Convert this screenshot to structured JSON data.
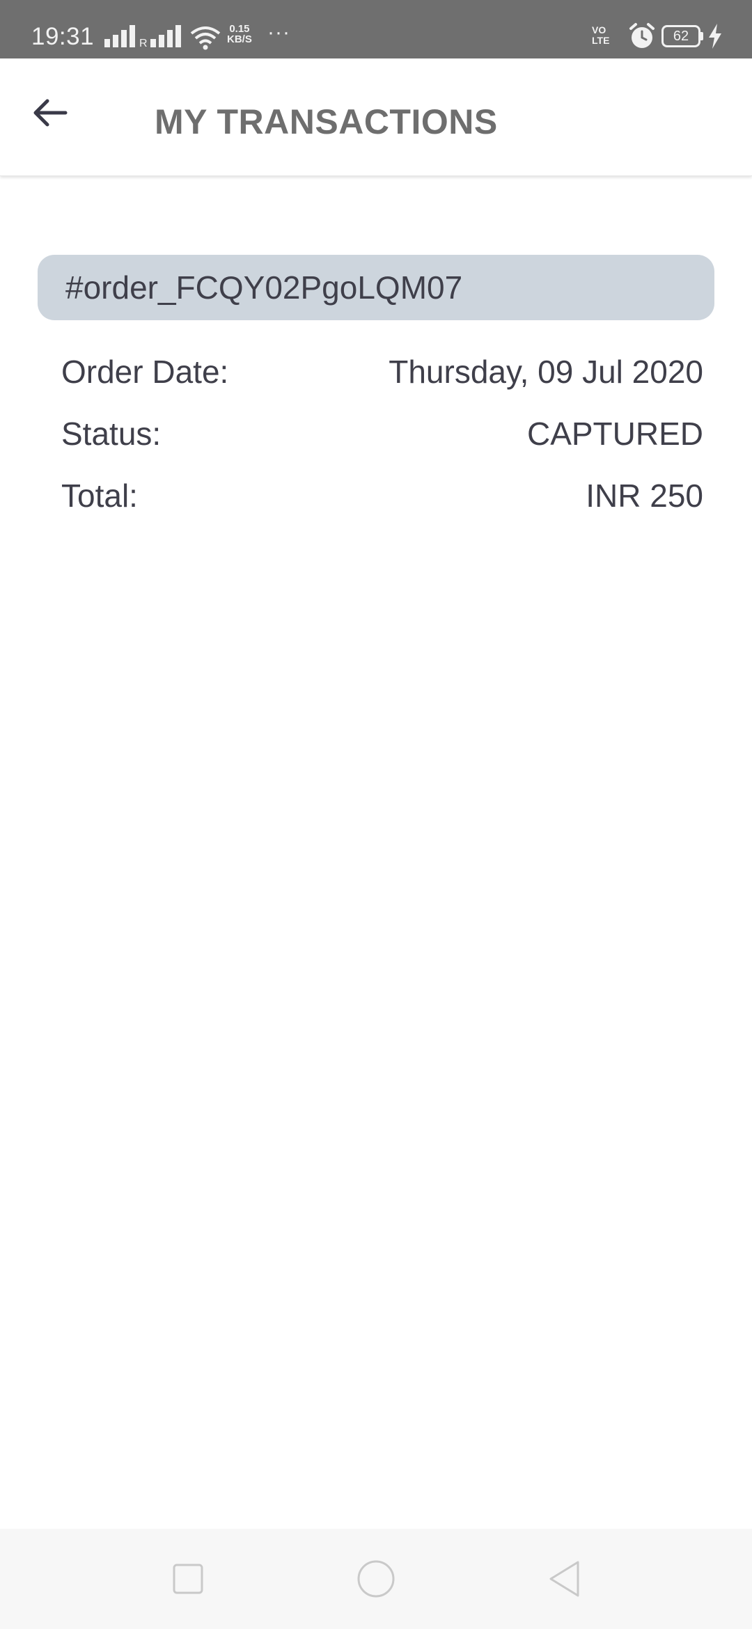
{
  "status_bar": {
    "time": "19:31",
    "network_speed_value": "0.15",
    "network_speed_unit": "KB/S",
    "overflow_dots": "···",
    "volte_top": "VO",
    "volte_bottom": "LTE",
    "battery_level": "62"
  },
  "app_bar": {
    "title": "MY TRANSACTIONS"
  },
  "order": {
    "id": "#order_FCQY02PgoLQM07",
    "rows": [
      {
        "label": "Order Date:",
        "value": "Thursday, 09 Jul 2020"
      },
      {
        "label": "Status:",
        "value": "CAPTURED"
      },
      {
        "label": "Total:",
        "value": "INR 250"
      }
    ]
  },
  "colors": {
    "status_bar_bg": "#6f6f6f",
    "title_text": "#6e6e6e",
    "order_header_bg": "#cdd5dd",
    "body_text": "#3f3f4a",
    "nav_bar_bg": "#f7f7f7"
  },
  "icons": {
    "back": "arrow-left-icon",
    "recents": "square-icon",
    "home": "circle-icon",
    "nav_back": "triangle-left-icon"
  }
}
